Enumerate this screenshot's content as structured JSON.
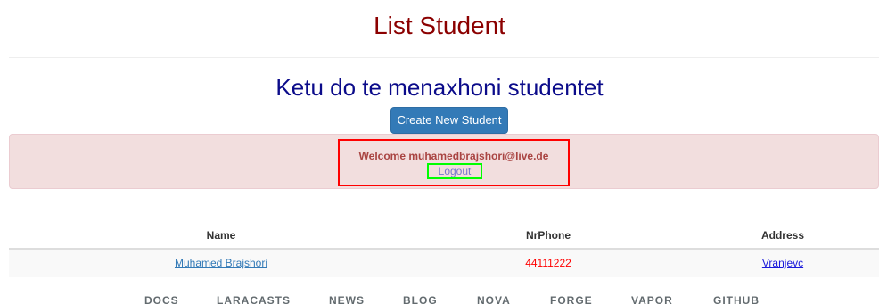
{
  "header": {
    "title": "List Student",
    "subtitle": "Ketu do te menaxhoni studentet",
    "create_button_label": "Create New Student"
  },
  "alert": {
    "welcome_text": "Welcome muhamedbrajshori@live.de",
    "logout_label": "Logout"
  },
  "table": {
    "columns": [
      "Name",
      "NrPhone",
      "Address"
    ],
    "rows": [
      {
        "name": "Muhamed Brajshori",
        "phone": "44111222",
        "address": "Vranjevc"
      }
    ]
  },
  "footer": {
    "links": [
      "DOCS",
      "LARACASTS",
      "NEWS",
      "BLOG",
      "NOVA",
      "FORGE",
      "VAPOR",
      "GITHUB"
    ]
  },
  "colors": {
    "title": "#8b0000",
    "subtitle": "#0b0b8a",
    "button": "#337ab7",
    "alert_bg": "#f2dede",
    "highlight_red": "#ff0000",
    "highlight_green": "#00ff00",
    "phone": "#ff0000"
  }
}
